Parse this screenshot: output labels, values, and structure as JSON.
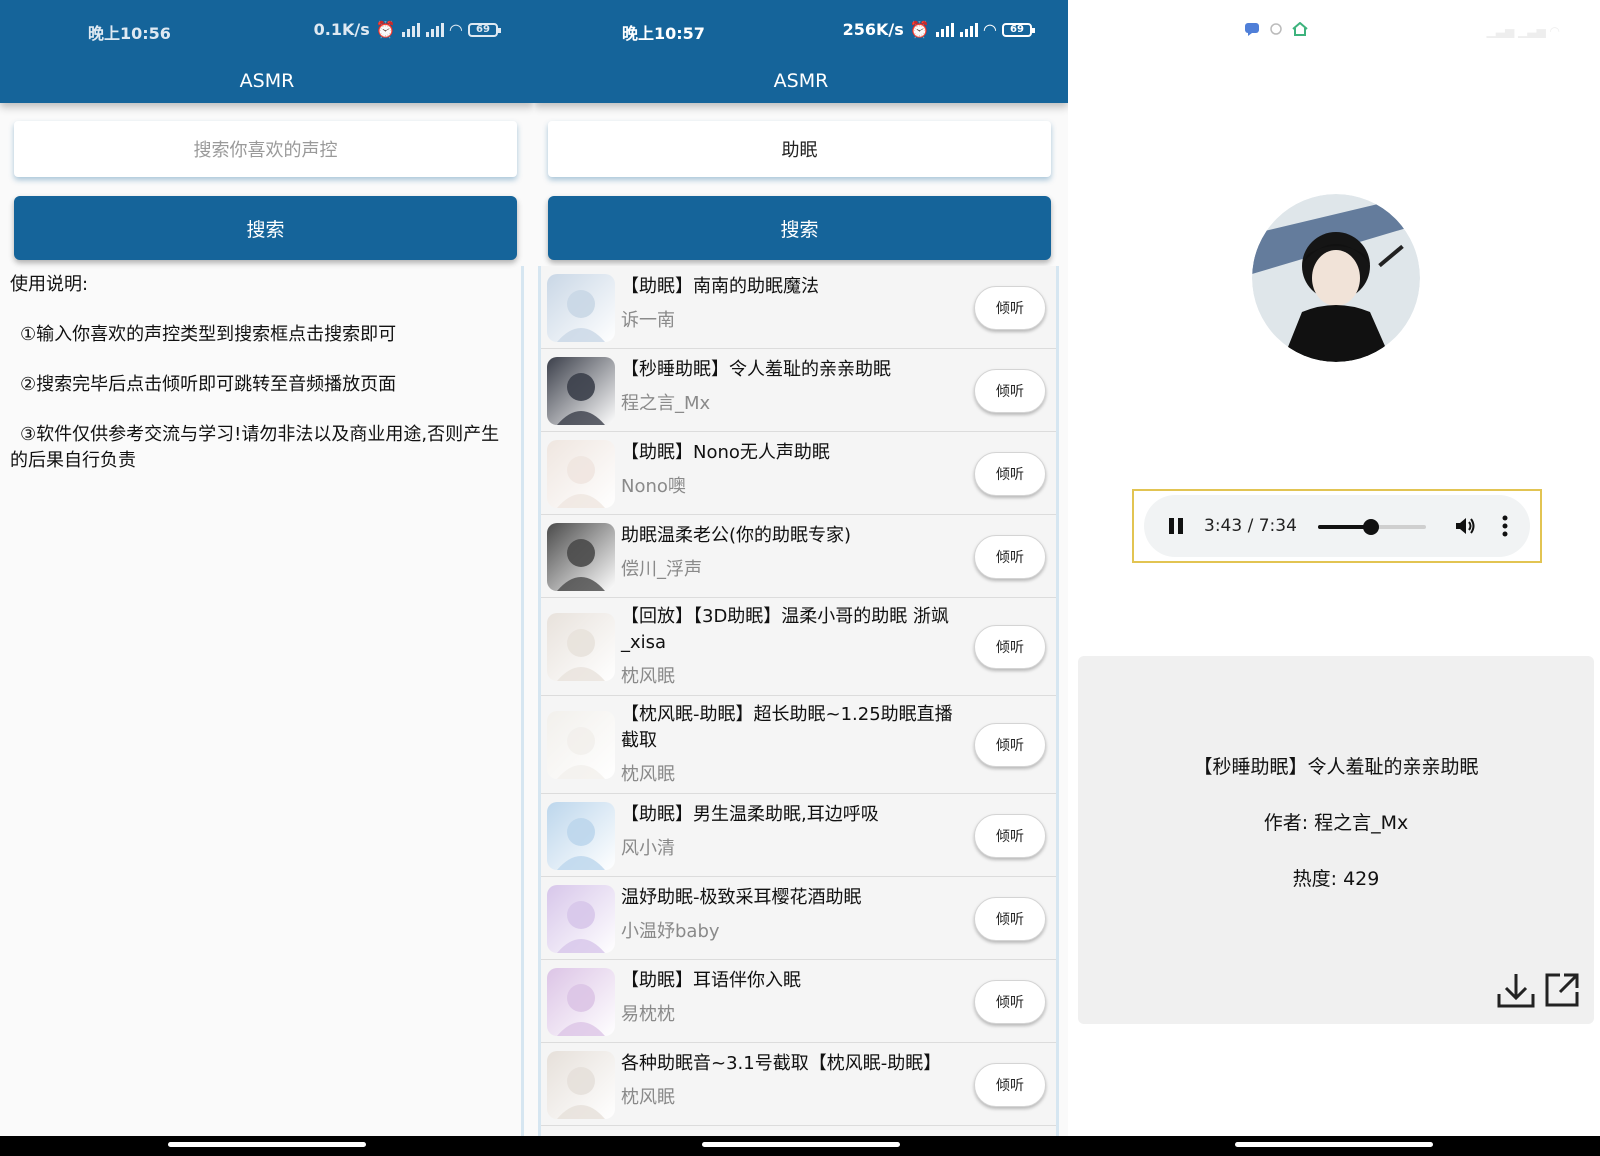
{
  "screen1": {
    "status": {
      "time": "晚上10:56",
      "speed": "0.1K/s",
      "battery": "69"
    },
    "title": "ASMR",
    "search_placeholder": "搜索你喜欢的声控",
    "search_button": "搜索",
    "usage": {
      "heading": "使用说明:",
      "lines": [
        "①输入你喜欢的声控类型到搜索框点击搜索即可",
        "②搜索完毕后点击倾听即可跳转至音频播放页面",
        "③软件仅供参考交流与学习!请勿非法以及商业用途,否则产生的后果自行负责"
      ]
    }
  },
  "screen2": {
    "status": {
      "time": "晚上10:57",
      "speed": "256K/s",
      "battery": "69"
    },
    "title": "ASMR",
    "search_value": "助眠",
    "search_button": "搜索",
    "listen_label": "倾听",
    "results": [
      {
        "title": "【助眠】南南的助眠魔法",
        "author": "诉一南",
        "color": "#c9d7e6"
      },
      {
        "title": "【秒睡助眠】令人羞耻的亲亲助眠",
        "author": "程之言_Mx",
        "color": "#3b3f4a"
      },
      {
        "title": "【助眠】Nono无人声助眠",
        "author": "Nono噢",
        "color": "#efe6e0"
      },
      {
        "title": "助眠温柔老公(你的助眠专家)",
        "author": "偿川_浮声",
        "color": "#4a4a4a"
      },
      {
        "title": "【回放】【3D助眠】温柔小哥的助眠 浙飒_xisa",
        "author": "枕风眠",
        "color": "#e8e2dc"
      },
      {
        "title": "【枕风眠-助眠】超长助眠~1.25助眠直播截取",
        "author": "枕风眠",
        "color": "#f2f0ec"
      },
      {
        "title": "【助眠】男生温柔助眠,耳边呼吸",
        "author": "风小清",
        "color": "#bcd6ec"
      },
      {
        "title": "温妤助眠-极致采耳樱花酒助眠",
        "author": "小温妤baby",
        "color": "#d7c6ea"
      },
      {
        "title": "【助眠】耳语伴你入眠",
        "author": "易枕枕",
        "color": "#dcc4e6"
      },
      {
        "title": "各种助眠音~3.1号截取【枕风眠-助眠】",
        "author": "枕风眠",
        "color": "#e6e0da"
      }
    ]
  },
  "screen3": {
    "player": {
      "current": "3:43",
      "total": "7:34",
      "progress": 0.49
    },
    "info": {
      "title": "【秒睡助眠】令人羞耻的亲亲助眠",
      "author_line": "作者: 程之言_Mx",
      "heat_line": "热度: 429"
    }
  }
}
